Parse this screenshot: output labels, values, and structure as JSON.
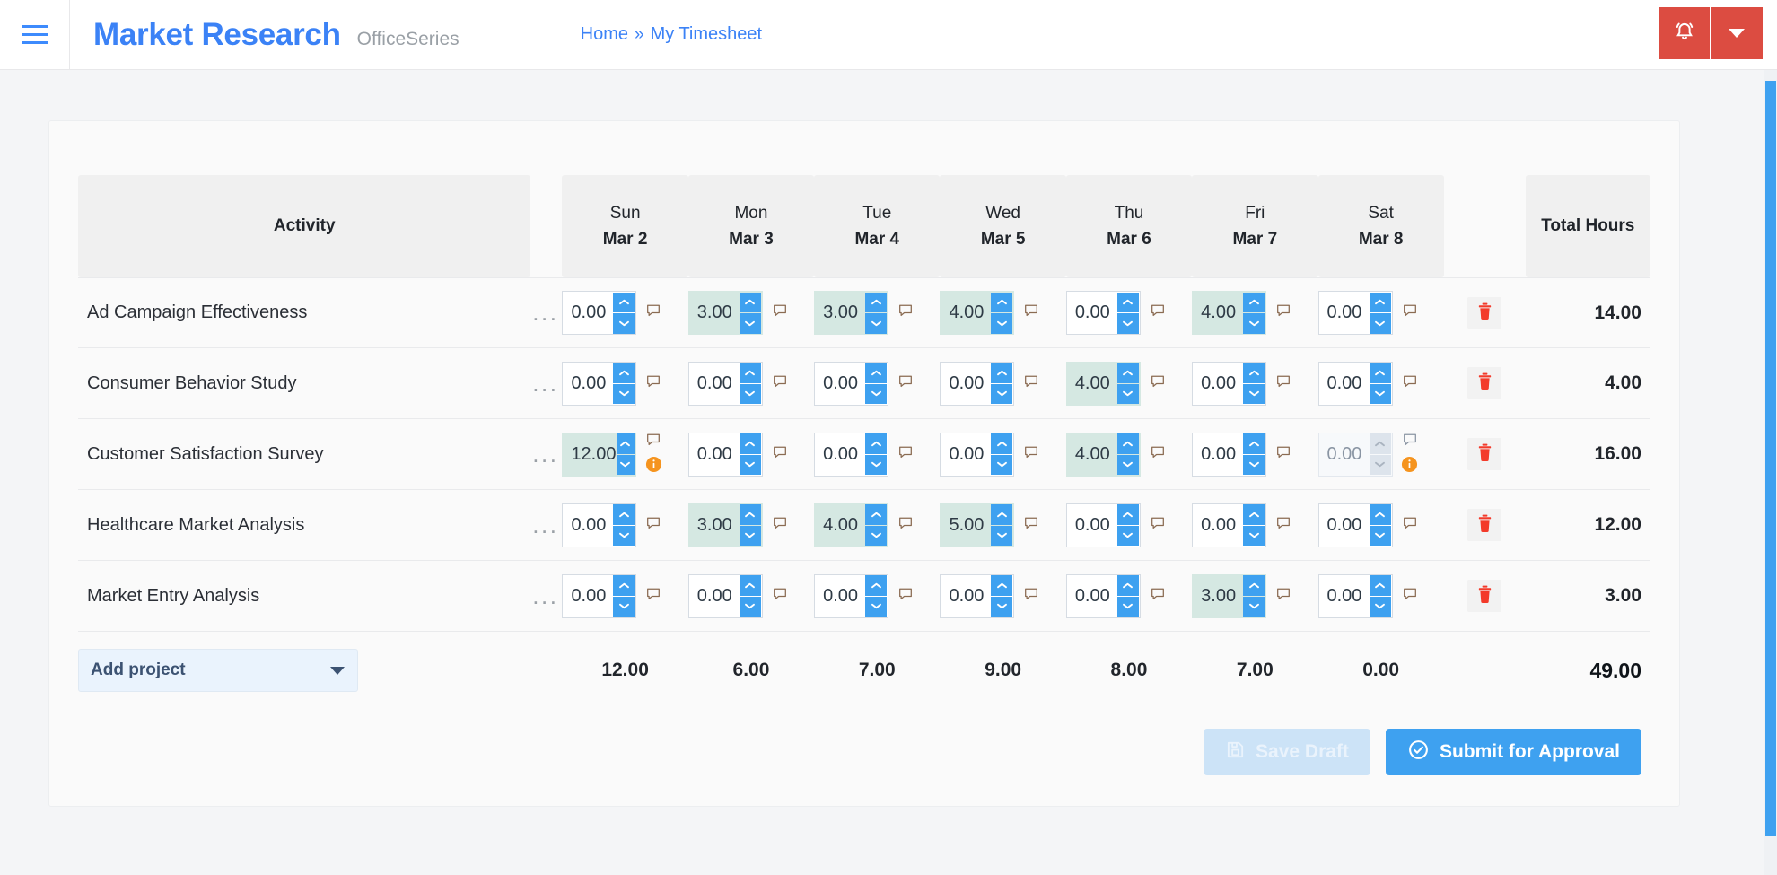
{
  "header": {
    "menu_icon": "hamburger-icon",
    "brand_title": "Market Research",
    "brand_subtitle": "OfficeSeries",
    "breadcrumb": {
      "home": "Home",
      "separator": "»",
      "current": "My Timesheet"
    },
    "bell_icon": "bell-icon",
    "caret_icon": "chevron-down-icon",
    "accent_red": "#dc4c41",
    "accent_blue": "#3b82f6"
  },
  "table": {
    "activity_header": "Activity",
    "total_header": "Total Hours",
    "days": [
      {
        "dow": "Sun",
        "date": "Mar 2"
      },
      {
        "dow": "Mon",
        "date": "Mar 3"
      },
      {
        "dow": "Tue",
        "date": "Mar 4"
      },
      {
        "dow": "Wed",
        "date": "Mar 5"
      },
      {
        "dow": "Thu",
        "date": "Mar 6"
      },
      {
        "dow": "Fri",
        "date": "Mar 7"
      },
      {
        "dow": "Sat",
        "date": "Mar 8"
      }
    ],
    "rows": [
      {
        "activity": "Ad Campaign Effectiveness",
        "menu": "...",
        "hours": [
          "0.00",
          "3.00",
          "3.00",
          "4.00",
          "0.00",
          "4.00",
          "0.00"
        ],
        "filled": [
          false,
          true,
          true,
          true,
          false,
          true,
          false
        ],
        "disabled": [
          false,
          false,
          false,
          false,
          false,
          false,
          false
        ],
        "info": [
          false,
          false,
          false,
          false,
          false,
          false,
          false
        ],
        "total": "14.00"
      },
      {
        "activity": "Consumer Behavior Study",
        "menu": "...",
        "hours": [
          "0.00",
          "0.00",
          "0.00",
          "0.00",
          "4.00",
          "0.00",
          "0.00"
        ],
        "filled": [
          false,
          false,
          false,
          false,
          true,
          false,
          false
        ],
        "disabled": [
          false,
          false,
          false,
          false,
          false,
          false,
          false
        ],
        "info": [
          false,
          false,
          false,
          false,
          false,
          false,
          false
        ],
        "total": "4.00"
      },
      {
        "activity": "Customer Satisfaction Survey",
        "menu": "...",
        "hours": [
          "12.00",
          "0.00",
          "0.00",
          "0.00",
          "4.00",
          "0.00",
          "0.00"
        ],
        "filled": [
          true,
          false,
          false,
          false,
          true,
          false,
          false
        ],
        "disabled": [
          false,
          false,
          false,
          false,
          false,
          false,
          true
        ],
        "info": [
          true,
          false,
          false,
          false,
          false,
          false,
          true
        ],
        "total": "16.00"
      },
      {
        "activity": "Healthcare Market Analysis",
        "menu": "...",
        "hours": [
          "0.00",
          "3.00",
          "4.00",
          "5.00",
          "0.00",
          "0.00",
          "0.00"
        ],
        "filled": [
          false,
          true,
          true,
          true,
          false,
          false,
          false
        ],
        "disabled": [
          false,
          false,
          false,
          false,
          false,
          false,
          false
        ],
        "info": [
          false,
          false,
          false,
          false,
          false,
          false,
          false
        ],
        "total": "12.00"
      },
      {
        "activity": "Market Entry Analysis",
        "menu": "...",
        "hours": [
          "0.00",
          "0.00",
          "0.00",
          "0.00",
          "0.00",
          "3.00",
          "0.00"
        ],
        "filled": [
          false,
          false,
          false,
          false,
          false,
          true,
          false
        ],
        "disabled": [
          false,
          false,
          false,
          false,
          false,
          false,
          false
        ],
        "info": [
          false,
          false,
          false,
          false,
          false,
          false,
          false
        ],
        "total": "3.00"
      }
    ],
    "day_totals": [
      "12.00",
      "6.00",
      "7.00",
      "9.00",
      "8.00",
      "7.00",
      "0.00"
    ],
    "grand_total": "49.00",
    "add_project_label": "Add project",
    "delete_icon": "trash-icon",
    "comment_icon": "comment-flag-icon",
    "info_icon": "info-circle-icon",
    "spinner_up_icon": "chevron-up-icon",
    "spinner_down_icon": "chevron-down-icon",
    "filled_cell_color": "#d5e8e2",
    "spinner_color": "#3ea1f0",
    "info_color": "#f5941f",
    "delete_color": "#f33a2a"
  },
  "footer": {
    "save_draft_label": "Save Draft",
    "save_draft_icon": "save-disk-icon",
    "submit_label": "Submit for Approval",
    "submit_icon": "check-circle-icon"
  },
  "scrollbar": {
    "name": "vertical-scrollbar"
  }
}
